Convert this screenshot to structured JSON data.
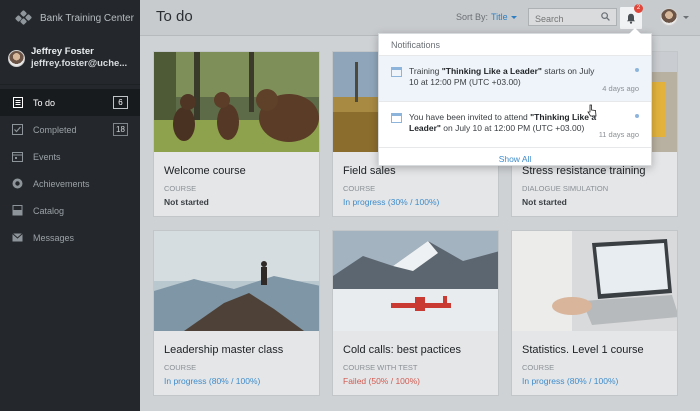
{
  "brand": {
    "title": "Bank Training Center"
  },
  "user": {
    "name": "Jeffrey Foster",
    "email": "jeffrey.foster@uche..."
  },
  "nav": [
    {
      "label": "To do",
      "count": "6",
      "icon": "list-icon",
      "active": true
    },
    {
      "label": "Completed",
      "count": "18",
      "icon": "check-icon"
    },
    {
      "label": "Events",
      "icon": "calendar-icon"
    },
    {
      "label": "Achievements",
      "icon": "medal-icon"
    },
    {
      "label": "Catalog",
      "icon": "catalog-icon"
    },
    {
      "label": "Messages",
      "icon": "mail-icon"
    }
  ],
  "header": {
    "title": "To do",
    "sort_label": "Sort By:",
    "sort_value": "Title",
    "search_placeholder": "Search",
    "notification_count": "2"
  },
  "cards": [
    {
      "title": "Welcome course",
      "type": "COURSE",
      "status": "Not started",
      "status_kind": "notstarted"
    },
    {
      "title": "Field sales",
      "type": "COURSE",
      "status": "In progress (30% / 100%)",
      "status_kind": "progress",
      "progress": 30
    },
    {
      "title": "Stress resistance training",
      "type": "DIALOGUE SIMULATION",
      "status": "Not started",
      "status_kind": "notstarted"
    },
    {
      "title": "Leadership master class",
      "type": "COURSE",
      "status": "In progress (80% / 100%)",
      "status_kind": "progress",
      "progress": 80
    },
    {
      "title": "Cold calls: best pactices",
      "type": "COURSE WITH TEST",
      "status": "Failed (50% / 100%)",
      "status_kind": "failed",
      "progress": 50
    },
    {
      "title": "Statistics. Level 1 course",
      "type": "COURSE",
      "status": "In progress (80% / 100%)",
      "status_kind": "progress",
      "progress": 80
    }
  ],
  "notifications": {
    "title": "Notifications",
    "items": [
      {
        "prefix": "Training ",
        "bold": "\"Thinking Like a Leader\"",
        "suffix": " starts on July 10 at 12:00 PM (UTC +03.00)",
        "time": "4 days ago"
      },
      {
        "prefix": "You have been invited to attend ",
        "bold": "\"Thinking Like a Leader\"",
        "suffix": " on July 10 at 12:00 PM (UTC +03.00)",
        "time": "11 days ago"
      }
    ],
    "footer": "Show All"
  },
  "colors": {
    "accent": "#2e7fc1",
    "progress": "#3f8ccb",
    "failed": "#d25a50",
    "badge": "#e0473a",
    "sidebar": "#24282c"
  }
}
